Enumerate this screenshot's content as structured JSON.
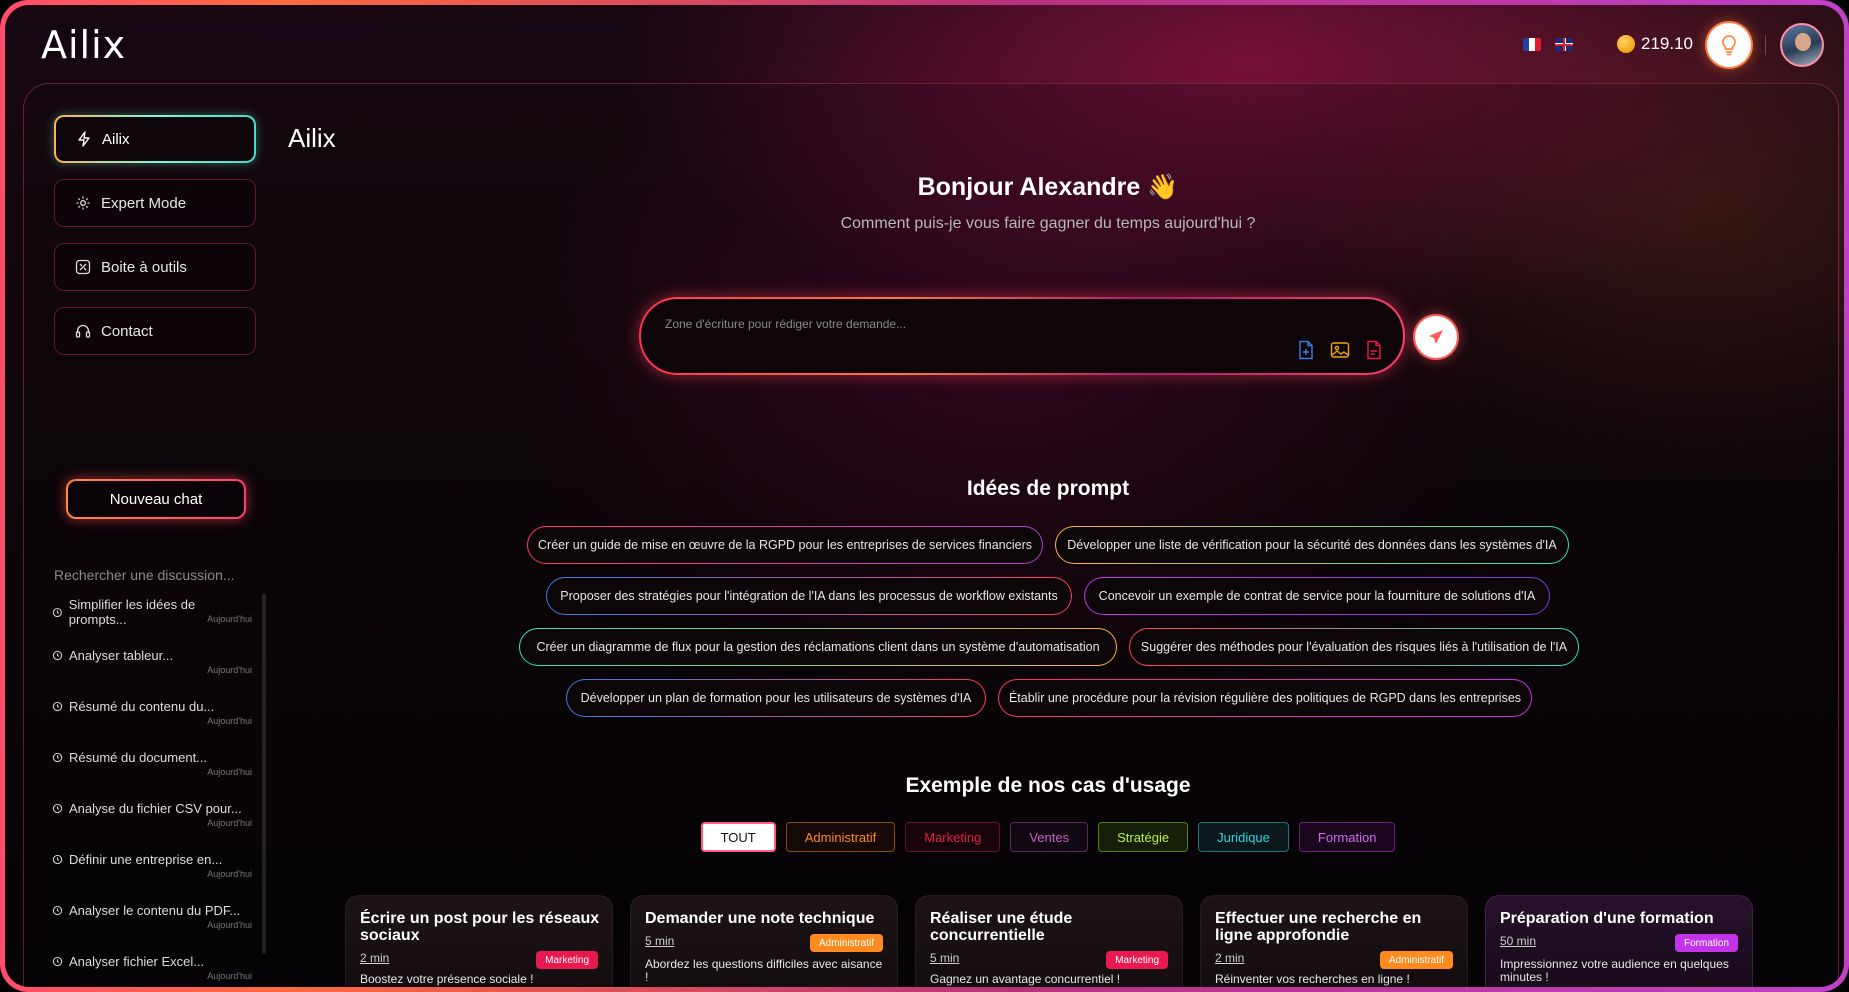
{
  "header": {
    "logo": "Ailix",
    "credits": "219.10"
  },
  "sidebar": {
    "nav": [
      {
        "label": "Ailix",
        "icon": "bolt-icon",
        "active": true
      },
      {
        "label": "Expert Mode",
        "icon": "gear-icon",
        "active": false
      },
      {
        "label": "Boite à outils",
        "icon": "toolbox-icon",
        "active": false
      },
      {
        "label": "Contact",
        "icon": "headset-icon",
        "active": false
      }
    ],
    "new_chat_label": "Nouveau chat",
    "search_placeholder": "Rechercher une discussion...",
    "history": [
      {
        "title": "Simplifier les idées de prompts...",
        "date": "Aujourd'hui"
      },
      {
        "title": "Analyser tableur...",
        "date": "Aujourd'hui"
      },
      {
        "title": "Résumé du contenu du...",
        "date": "Aujourd'hui"
      },
      {
        "title": "Résumé du document...",
        "date": "Aujourd'hui"
      },
      {
        "title": "Analyse du fichier CSV pour...",
        "date": "Aujourd'hui"
      },
      {
        "title": "Définir une entreprise en...",
        "date": "Aujourd'hui"
      },
      {
        "title": "Analyser le contenu du PDF...",
        "date": "Aujourd'hui"
      },
      {
        "title": "Analyser fichier Excel...",
        "date": "Aujourd'hui"
      }
    ]
  },
  "main": {
    "page_title": "Ailix",
    "greeting": "Bonjour Alexandre 👋",
    "subtitle": "Comment puis-je vous faire gagner du temps aujourd'hui ?",
    "prompt_placeholder": "Zone d'écriture pour rédiger votre demande...",
    "ideas_title": "Idées de prompt",
    "ideas": [
      "Créer un guide de mise en œuvre de la RGPD pour les entreprises de services financiers",
      "Développer une liste de vérification pour la sécurité des données dans les systèmes d'IA",
      "Proposer des stratégies pour l'intégration de l'IA dans les processus de workflow existants",
      "Concevoir un exemple de contrat de service pour la fourniture de solutions d'IA",
      "Créer un diagramme de flux pour la gestion des réclamations client dans un système d'automatisation",
      "Suggérer des méthodes pour l'évaluation des risques liés à l'utilisation de l'IA",
      "Développer un plan de formation pour les utilisateurs de systèmes d'IA",
      "Établir une procédure pour la révision régulière des politiques de RGPD dans les entreprises"
    ],
    "usecases_title": "Exemple de nos cas d'usage",
    "filters": [
      "TOUT",
      "Administratif",
      "Marketing",
      "Ventes",
      "Stratégie",
      "Juridique",
      "Formation"
    ],
    "cards": [
      {
        "title": "Écrire un post pour les réseaux sociaux",
        "duration": "2 min",
        "badge": "Marketing",
        "desc": "Boostez votre présence sociale !"
      },
      {
        "title": "Demander une note technique",
        "duration": "5 min",
        "badge": "Administratif",
        "desc": "Abordez les questions difficiles avec aisance !"
      },
      {
        "title": "Réaliser une étude concurrentielle",
        "duration": "5 min",
        "badge": "Marketing",
        "desc": "Gagnez un avantage concurrentiel !"
      },
      {
        "title": "Effectuer une recherche en ligne approfondie",
        "duration": "2 min",
        "badge": "Administratif",
        "desc": "Réinventer vos recherches en ligne !"
      },
      {
        "title": "Préparation d'une formation",
        "duration": "50 min",
        "badge": "Formation",
        "desc": "Impressionnez votre audience en quelques minutes !"
      }
    ]
  },
  "colors": {
    "marketing": "#e8194f",
    "administratif": "#ff8a1f",
    "formation": "#c234e8",
    "ventes": "#c85fd0",
    "strategie": "#8ee32d",
    "juridique": "#2ed4e0"
  }
}
